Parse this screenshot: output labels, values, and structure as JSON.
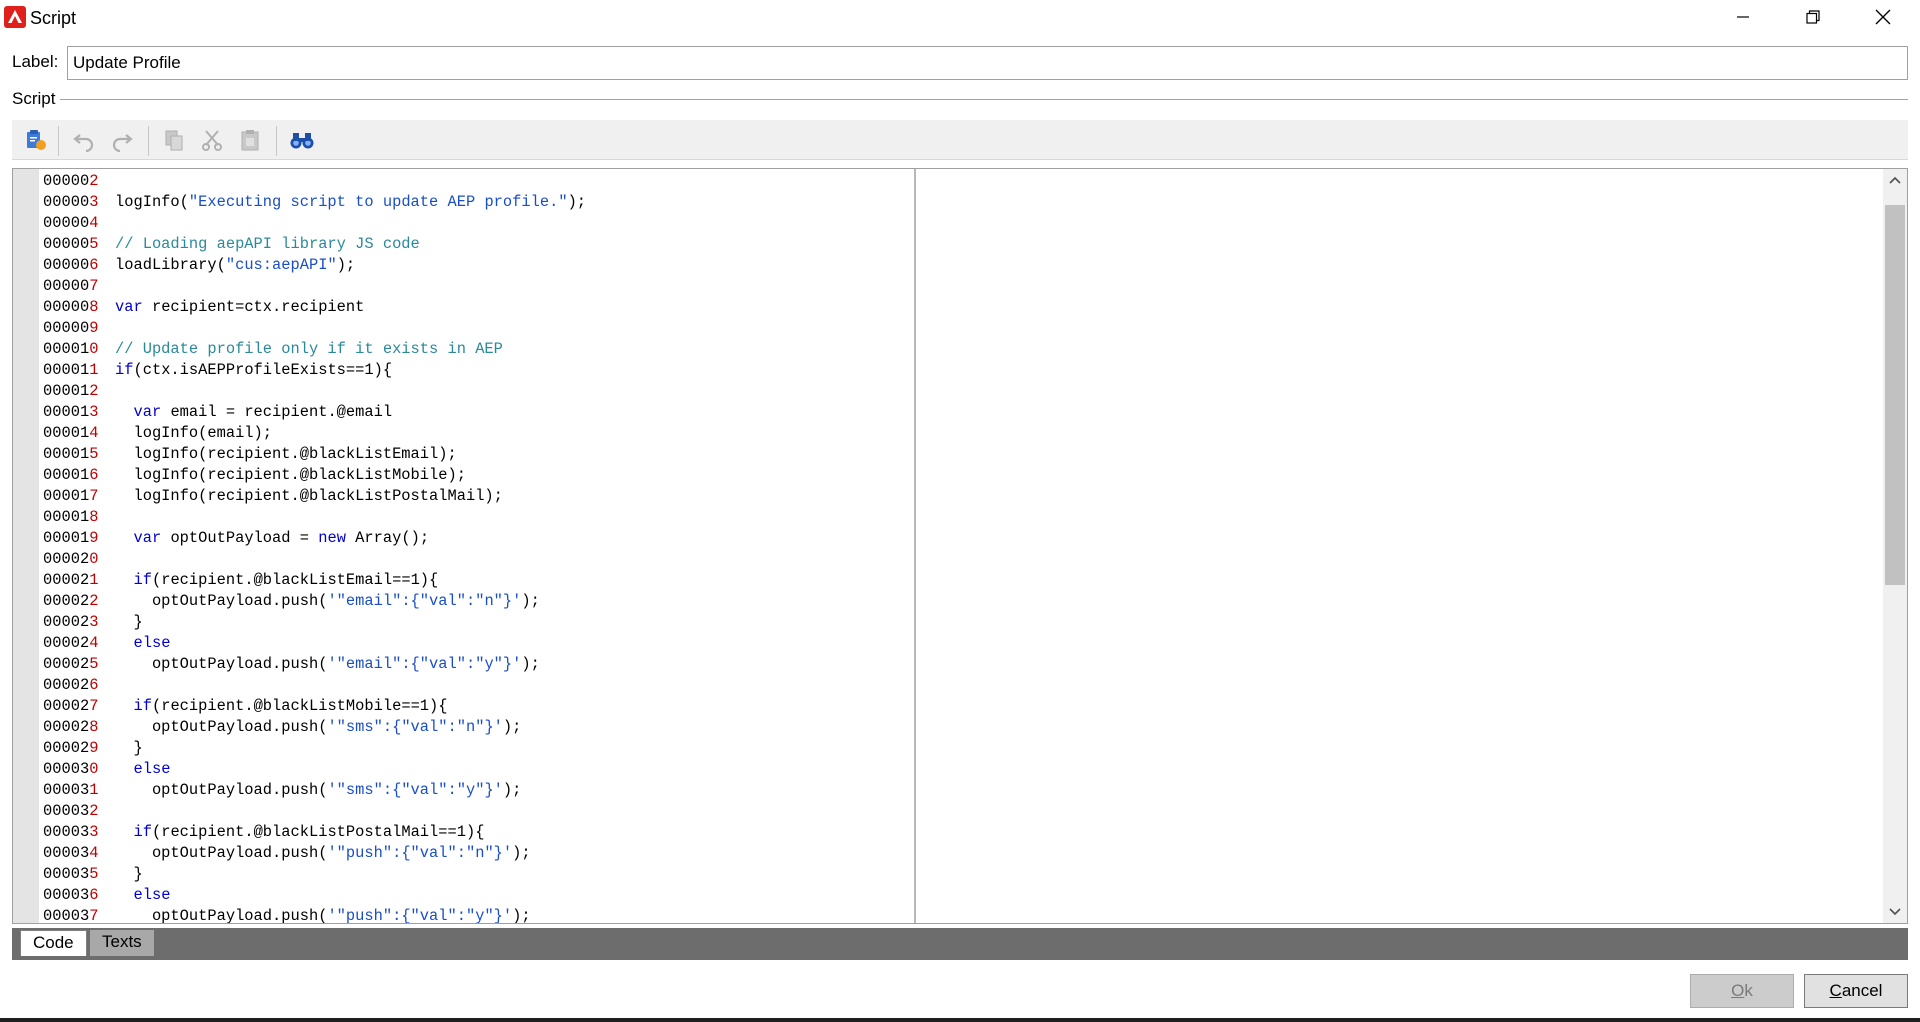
{
  "window": {
    "title": "Script",
    "icon": "adobe-logo-icon",
    "accent_color": "#e0201b",
    "controls": [
      "minimize-icon",
      "restore-icon",
      "close-icon"
    ]
  },
  "label_field": {
    "caption": "Label:",
    "value": "Update Profile"
  },
  "section": {
    "caption": "Script"
  },
  "toolbar": {
    "items": [
      "insert-function-icon",
      "undo-icon",
      "redo-icon",
      "copy-icon",
      "cut-icon",
      "paste-icon",
      "find-icon"
    ]
  },
  "editor": {
    "lines": [
      {
        "n": "000002",
        "tokens": []
      },
      {
        "n": "000003",
        "tokens": [
          [
            "plain",
            "logInfo("
          ],
          [
            "str",
            "\"Executing script to update AEP profile.\""
          ],
          [
            "plain",
            ");"
          ]
        ]
      },
      {
        "n": "000004",
        "tokens": []
      },
      {
        "n": "000005",
        "tokens": [
          [
            "com",
            "// Loading aepAPI library JS code"
          ]
        ]
      },
      {
        "n": "000006",
        "tokens": [
          [
            "plain",
            "loadLibrary("
          ],
          [
            "str",
            "\"cus:aepAPI\""
          ],
          [
            "plain",
            ");"
          ]
        ]
      },
      {
        "n": "000007",
        "tokens": []
      },
      {
        "n": "000008",
        "tokens": [
          [
            "kw",
            "var"
          ],
          [
            "plain",
            " recipient=ctx.recipient"
          ]
        ]
      },
      {
        "n": "000009",
        "tokens": []
      },
      {
        "n": "000010",
        "tokens": [
          [
            "com",
            "// Update profile only if it exists in AEP"
          ]
        ]
      },
      {
        "n": "000011",
        "tokens": [
          [
            "kw",
            "if"
          ],
          [
            "plain",
            "(ctx.isAEPProfileExists==1){"
          ]
        ]
      },
      {
        "n": "000012",
        "tokens": []
      },
      {
        "n": "000013",
        "tokens": [
          [
            "plain",
            "  "
          ],
          [
            "kw",
            "var"
          ],
          [
            "plain",
            " email = recipient.@email"
          ]
        ]
      },
      {
        "n": "000014",
        "tokens": [
          [
            "plain",
            "  logInfo(email);"
          ]
        ]
      },
      {
        "n": "000015",
        "tokens": [
          [
            "plain",
            "  logInfo(recipient.@blackListEmail);"
          ]
        ]
      },
      {
        "n": "000016",
        "tokens": [
          [
            "plain",
            "  logInfo(recipient.@blackListMobile);"
          ]
        ]
      },
      {
        "n": "000017",
        "tokens": [
          [
            "plain",
            "  logInfo(recipient.@blackListPostalMail);"
          ]
        ]
      },
      {
        "n": "000018",
        "tokens": []
      },
      {
        "n": "000019",
        "tokens": [
          [
            "plain",
            "  "
          ],
          [
            "kw",
            "var"
          ],
          [
            "plain",
            " optOutPayload = "
          ],
          [
            "kw",
            "new"
          ],
          [
            "plain",
            " Array();"
          ]
        ]
      },
      {
        "n": "000020",
        "tokens": []
      },
      {
        "n": "000021",
        "tokens": [
          [
            "plain",
            "  "
          ],
          [
            "kw",
            "if"
          ],
          [
            "plain",
            "(recipient.@blackListEmail==1){"
          ]
        ]
      },
      {
        "n": "000022",
        "tokens": [
          [
            "plain",
            "    optOutPayload.push("
          ],
          [
            "str",
            "'\"email\":{\"val\":\"n\"}'"
          ],
          [
            "plain",
            ");"
          ]
        ]
      },
      {
        "n": "000023",
        "tokens": [
          [
            "plain",
            "  }"
          ]
        ]
      },
      {
        "n": "000024",
        "tokens": [
          [
            "plain",
            "  "
          ],
          [
            "kw",
            "else"
          ]
        ]
      },
      {
        "n": "000025",
        "tokens": [
          [
            "plain",
            "    optOutPayload.push("
          ],
          [
            "str",
            "'\"email\":{\"val\":\"y\"}'"
          ],
          [
            "plain",
            ");"
          ]
        ]
      },
      {
        "n": "000026",
        "tokens": []
      },
      {
        "n": "000027",
        "tokens": [
          [
            "plain",
            "  "
          ],
          [
            "kw",
            "if"
          ],
          [
            "plain",
            "(recipient.@blackListMobile==1){"
          ]
        ]
      },
      {
        "n": "000028",
        "tokens": [
          [
            "plain",
            "    optOutPayload.push("
          ],
          [
            "str",
            "'\"sms\":{\"val\":\"n\"}'"
          ],
          [
            "plain",
            ");"
          ]
        ]
      },
      {
        "n": "000029",
        "tokens": [
          [
            "plain",
            "  }"
          ]
        ]
      },
      {
        "n": "000030",
        "tokens": [
          [
            "plain",
            "  "
          ],
          [
            "kw",
            "else"
          ]
        ]
      },
      {
        "n": "000031",
        "tokens": [
          [
            "plain",
            "    optOutPayload.push("
          ],
          [
            "str",
            "'\"sms\":{\"val\":\"y\"}'"
          ],
          [
            "plain",
            ");"
          ]
        ]
      },
      {
        "n": "000032",
        "tokens": []
      },
      {
        "n": "000033",
        "tokens": [
          [
            "plain",
            "  "
          ],
          [
            "kw",
            "if"
          ],
          [
            "plain",
            "(recipient.@blackListPostalMail==1){"
          ]
        ]
      },
      {
        "n": "000034",
        "tokens": [
          [
            "plain",
            "    optOutPayload.push("
          ],
          [
            "str",
            "'\"push\":{\"val\":\"n\"}'"
          ],
          [
            "plain",
            ");"
          ]
        ]
      },
      {
        "n": "000035",
        "tokens": [
          [
            "plain",
            "  }"
          ]
        ]
      },
      {
        "n": "000036",
        "tokens": [
          [
            "plain",
            "  "
          ],
          [
            "kw",
            "else"
          ]
        ]
      },
      {
        "n": "000037",
        "tokens": [
          [
            "plain",
            "    optOutPayload.push("
          ],
          [
            "str",
            "'\"push\":{\"val\":\"y\"}'"
          ],
          [
            "plain",
            ");"
          ]
        ]
      }
    ]
  },
  "tabs": [
    {
      "label": "Code",
      "active": true
    },
    {
      "label": "Texts",
      "active": false
    }
  ],
  "buttons": {
    "ok": "Ok",
    "cancel": "Cancel"
  }
}
